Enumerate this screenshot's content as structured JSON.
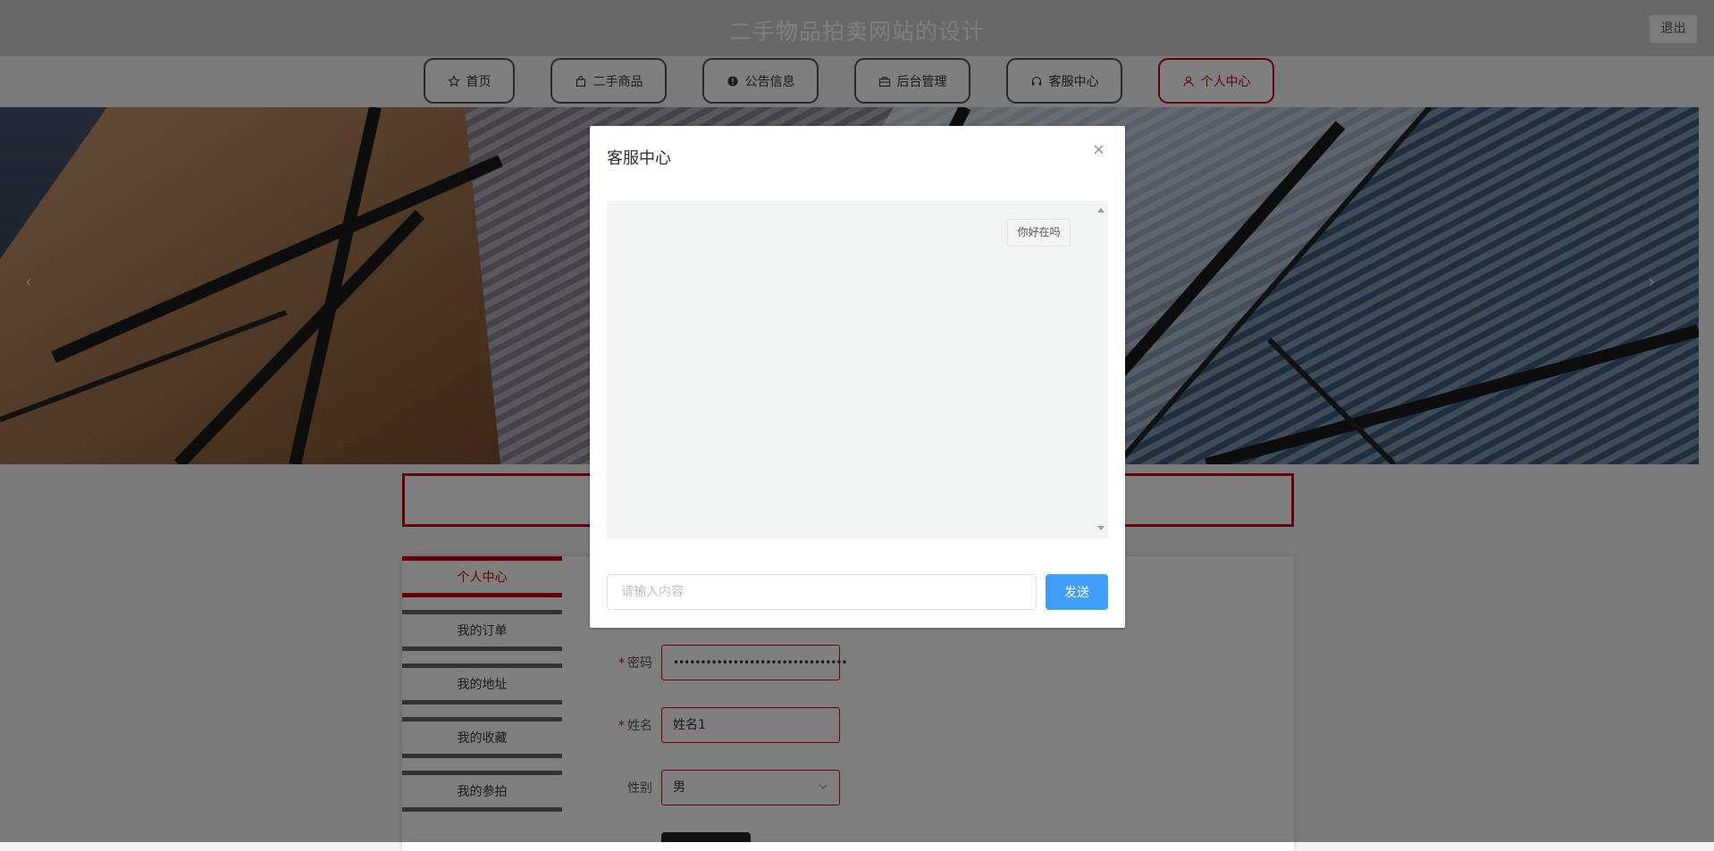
{
  "header": {
    "title": "二手物品拍卖网站的设计",
    "logout_label": "退出"
  },
  "nav": {
    "items": [
      {
        "label": "首页",
        "icon": "star-icon"
      },
      {
        "label": "二手商品",
        "icon": "bag-icon"
      },
      {
        "label": "公告信息",
        "icon": "info-icon"
      },
      {
        "label": "后台管理",
        "icon": "briefcase-icon"
      },
      {
        "label": "客服中心",
        "icon": "headset-icon"
      },
      {
        "label": "个人中心",
        "icon": "user-icon",
        "active": true
      }
    ]
  },
  "banner": {
    "prev_arrow": "‹",
    "next_arrow": "›"
  },
  "side_menu": {
    "items": [
      "个人中心",
      "我的订单",
      "我的地址",
      "我的收藏",
      "我的参拍"
    ]
  },
  "form": {
    "password": {
      "label": "密码",
      "value": "••••••••••••••••••••••••••••••••",
      "required": true
    },
    "name": {
      "label": "姓名",
      "value": "姓名1",
      "required": true
    },
    "gender": {
      "label": "性别",
      "value": "男"
    }
  },
  "modal": {
    "title": "客服中心",
    "close_icon": "×",
    "messages": [
      {
        "text": "你好在吗"
      }
    ],
    "input_placeholder": "请输入内容",
    "send_label": "发送"
  },
  "colors": {
    "accent": "#c8000f",
    "primary": "#409eff"
  }
}
